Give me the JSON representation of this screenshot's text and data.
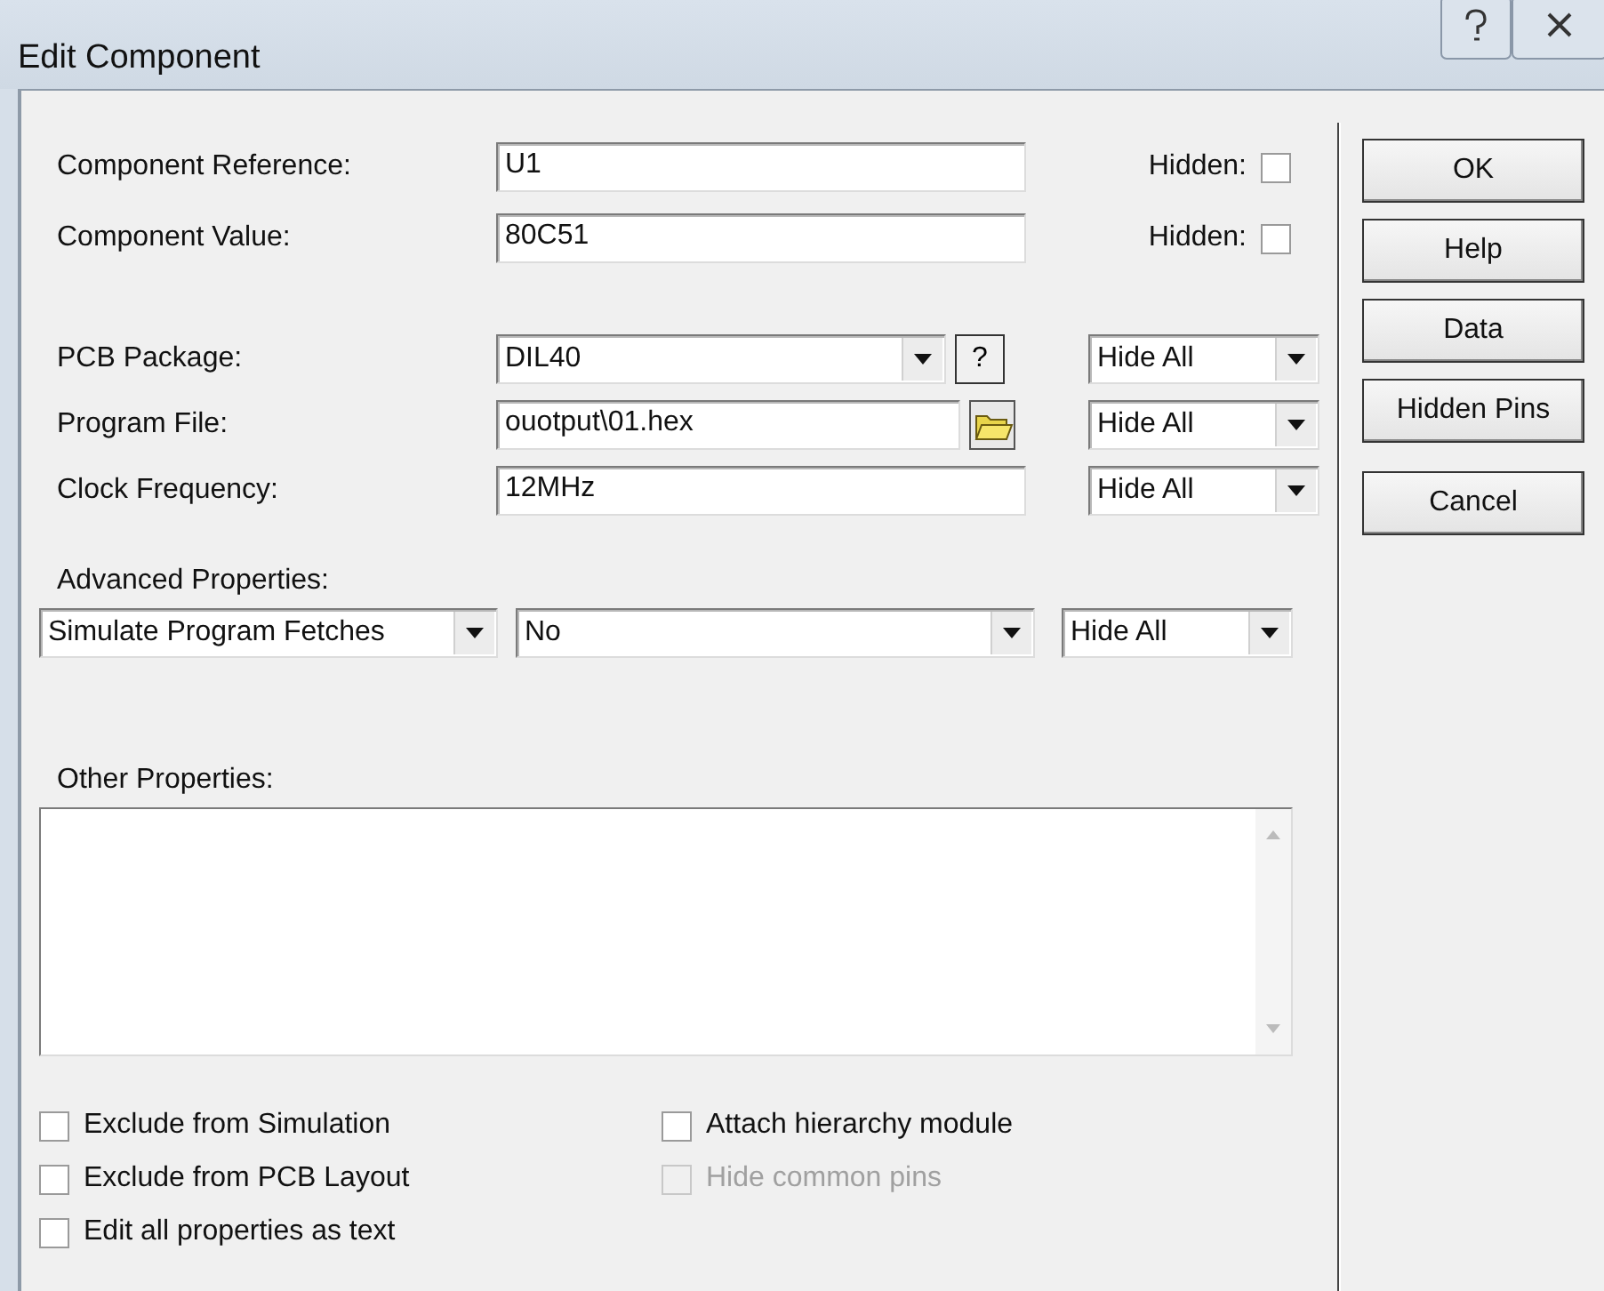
{
  "window": {
    "title": "Edit Component"
  },
  "fields": [
    {
      "label": "Component Reference:",
      "value": "U1",
      "hidden_label": "Hidden:",
      "hidden_checked": false
    },
    {
      "label": "Component Value:",
      "value": "80C51",
      "hidden_label": "Hidden:",
      "hidden_checked": false
    }
  ],
  "properties": [
    {
      "kind": "combo",
      "label": "PCB Package:",
      "value": "DIL40",
      "button": "?",
      "visibility": "Hide All"
    },
    {
      "kind": "file",
      "label": "Program File:",
      "value": "ouotput\\01.hex",
      "visibility": "Hide All"
    },
    {
      "kind": "text",
      "label": "Clock Frequency:",
      "value": "12MHz",
      "visibility": "Hide All"
    }
  ],
  "advanced": {
    "label": "Advanced Properties:",
    "property": "Simulate Program Fetches",
    "value": "No",
    "visibility": "Hide All"
  },
  "other_properties": {
    "label": "Other Properties:"
  },
  "options": [
    [
      {
        "label": "Exclude from Simulation",
        "checked": false,
        "disabled": false
      },
      {
        "label": "Exclude from PCB Layout",
        "checked": false,
        "disabled": false
      },
      {
        "label": "Edit all properties as text",
        "checked": false,
        "disabled": false
      }
    ],
    [
      {
        "label": "Attach hierarchy module",
        "checked": false,
        "disabled": false
      },
      {
        "label": "Hide common pins",
        "checked": false,
        "disabled": true
      }
    ]
  ],
  "buttons": [
    {
      "label": "OK"
    },
    {
      "label": "Help"
    },
    {
      "label": "Data"
    },
    {
      "label": "Hidden Pins"
    },
    {
      "label": "Cancel"
    }
  ]
}
